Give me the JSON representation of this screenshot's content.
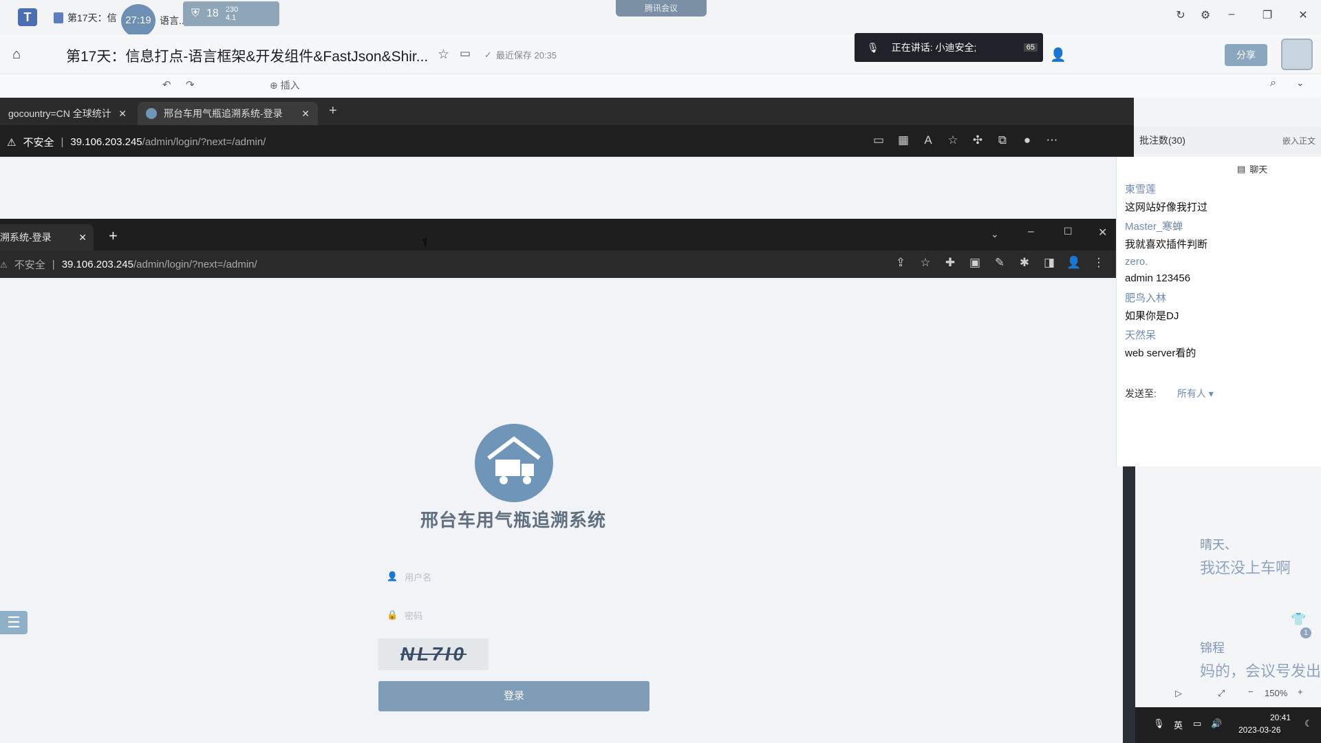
{
  "doc_app": {
    "tab_title": "第17天：信",
    "tab_title_suffix": "语言...",
    "timer": "27:19",
    "net": {
      "value": "18",
      "up": "230",
      "down": "4.1"
    },
    "meeting_pill": "腾讯会议",
    "title": "第17天：信息打点-语言框架&开发组件&FastJson&Shir...",
    "saved": "最近保存 20:35",
    "speaking": "正在讲话: 小迪安全;",
    "speaking_count": "65",
    "share_label": "分享",
    "ribbon_insert": "插入"
  },
  "browser1": {
    "tab1": "gocountry=CN 全球统计 - 1",
    "tab2": "邢台车用气瓶追溯系统-登录",
    "insecure": "不安全",
    "url_host": "39.106.203.245",
    "url_path": "/admin/login/?next=/admin/"
  },
  "browser2": {
    "tab": "溯系统-登录",
    "insecure": "不安全",
    "url_host": "39.106.203.245",
    "url_path": "/admin/login/?next=/admin/"
  },
  "login": {
    "system_title": "邢台车用气瓶追溯系统",
    "username_placeholder": "用户名",
    "password_placeholder": "密码",
    "captcha": "NL7I0",
    "login_button": "登录"
  },
  "comments": {
    "count_label": "批注数(30)",
    "embed_label": "嵌入正文"
  },
  "chat": {
    "header": "聊天",
    "messages": [
      {
        "name": "柬雪莲",
        "text": "这网站好像我打过"
      },
      {
        "name": "Master_寒蝉",
        "text": "我就喜欢插件判断"
      },
      {
        "name": "zero.",
        "text": "admin 123456"
      },
      {
        "name": "肥鸟入林",
        "text": "如果你是DJ"
      },
      {
        "name": "天然呆",
        "text": "web server看的"
      }
    ],
    "send_to_label": "发送至:",
    "send_to_value": "所有人"
  },
  "doc_side": {
    "c1_name": "晴天、",
    "c1_text": "我还没上车啊",
    "c2_name": "锦程",
    "c2_text": "妈的，会议号发出",
    "c2_badge": "1"
  },
  "zoom": {
    "value": "150%"
  },
  "taskbar": {
    "ime": "英",
    "time": "20:41",
    "date": "2023-03-26"
  }
}
